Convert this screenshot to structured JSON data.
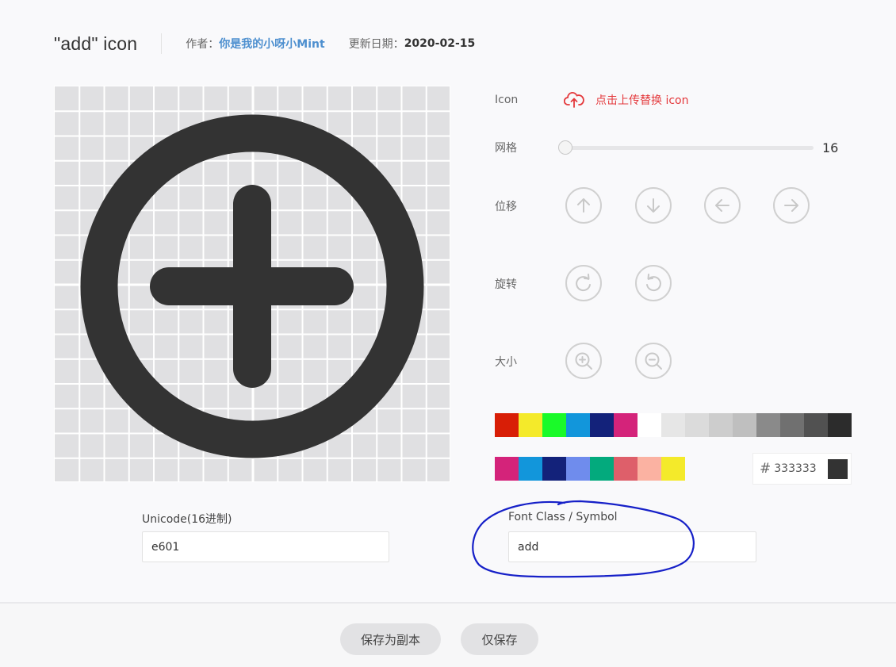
{
  "header": {
    "title": "\"add\"  icon",
    "author_label": "作者：",
    "author_name": "你是我的小呀小Mint",
    "date_label": "更新日期：",
    "date_value": "2020-02-15"
  },
  "panel": {
    "icon_label": "Icon",
    "upload_text": "点击上传替换 icon",
    "grid_label": "网格",
    "grid_value": "16",
    "move_label": "位移",
    "rotate_label": "旋转",
    "size_label": "大小"
  },
  "colors": {
    "row1": [
      "#d81e06",
      "#f4ea2a",
      "#1afa29",
      "#1296db",
      "#13227a",
      "#d4237a",
      "#ffffff",
      "#e6e6e6",
      "#dbdbdb",
      "#cdcdcd",
      "#bfbfbf",
      "#8a8a8a",
      "#707070",
      "#515151",
      "#2c2c2c"
    ],
    "row2": [
      "#d4237a",
      "#1296db",
      "#13227a",
      "#6f8ced",
      "#03aa7d",
      "#de5f6a",
      "#fbb2a2",
      "#f4ea2a"
    ],
    "hash": "#",
    "current_hex": "333333",
    "icon_color": "#333333",
    "accent_red": "#e4393c",
    "author_blue": "#4d8fcf"
  },
  "fields": {
    "unicode_label": "Unicode(16进制)",
    "unicode_value": "e601",
    "fontclass_label": "Font Class / Symbol",
    "fontclass_value": "add"
  },
  "footer": {
    "save_copy": "保存为副本",
    "save_only": "仅保存"
  }
}
